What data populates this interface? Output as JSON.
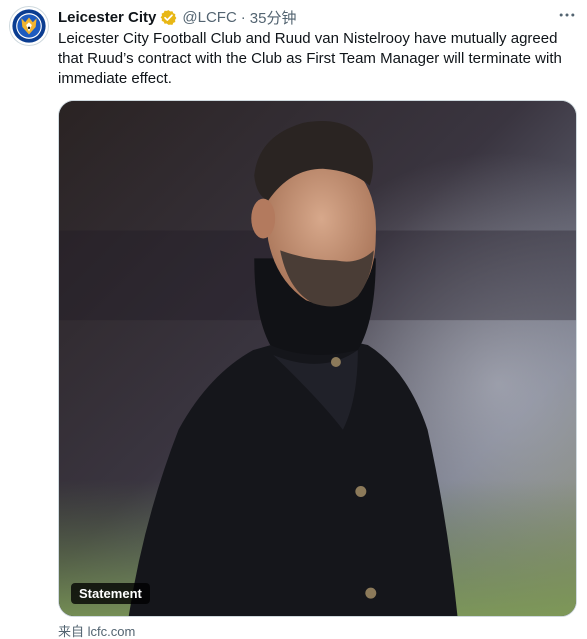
{
  "author": {
    "display_name": "Leicester City",
    "handle": "@LCFC",
    "separator": "·",
    "time": "35分钟",
    "verified": true,
    "verified_color": "#e8b715"
  },
  "tweet": {
    "text": "Leicester City Football Club and Ruud van Nistelrooy have mutually agreed that Ruud’s contract with the Club as First Team Manager will terminate with immediate effect."
  },
  "media": {
    "badge": "Statement",
    "subject": "man-in-black-coat-photo"
  },
  "source": {
    "label": "来自",
    "link": "lcfc.com"
  },
  "icons": {
    "avatar": "fox-crest-icon",
    "verified": "verified-badge-icon",
    "more": "more-icon"
  },
  "colors": {
    "text": "#0f1419",
    "muted": "#536471",
    "club_blue": "#003090"
  }
}
